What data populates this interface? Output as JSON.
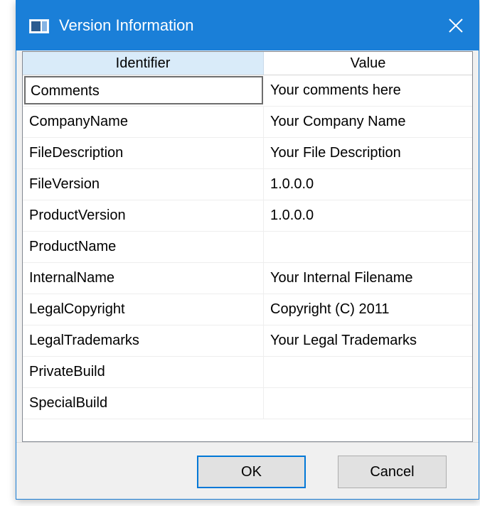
{
  "window": {
    "title": "Version Information",
    "icon": "app-window-icon",
    "close_icon": "close-icon"
  },
  "table": {
    "columns": [
      "Identifier",
      "Value"
    ],
    "rows": [
      {
        "identifier": "Comments",
        "value": "Your comments here",
        "selected": true
      },
      {
        "identifier": "CompanyName",
        "value": "Your Company Name"
      },
      {
        "identifier": "FileDescription",
        "value": "Your File Description"
      },
      {
        "identifier": "FileVersion",
        "value": "1.0.0.0"
      },
      {
        "identifier": "ProductVersion",
        "value": "1.0.0.0"
      },
      {
        "identifier": "ProductName",
        "value": ""
      },
      {
        "identifier": "InternalName",
        "value": "Your Internal Filename"
      },
      {
        "identifier": "LegalCopyright",
        "value": "Copyright (C) 2011"
      },
      {
        "identifier": "LegalTrademarks",
        "value": "Your Legal Trademarks"
      },
      {
        "identifier": "PrivateBuild",
        "value": ""
      },
      {
        "identifier": "SpecialBuild",
        "value": ""
      }
    ]
  },
  "buttons": {
    "ok": "OK",
    "cancel": "Cancel"
  },
  "colors": {
    "titlebar": "#1a7fd8",
    "header_selected": "#d9ebf9",
    "default_button_border": "#0078d7"
  }
}
